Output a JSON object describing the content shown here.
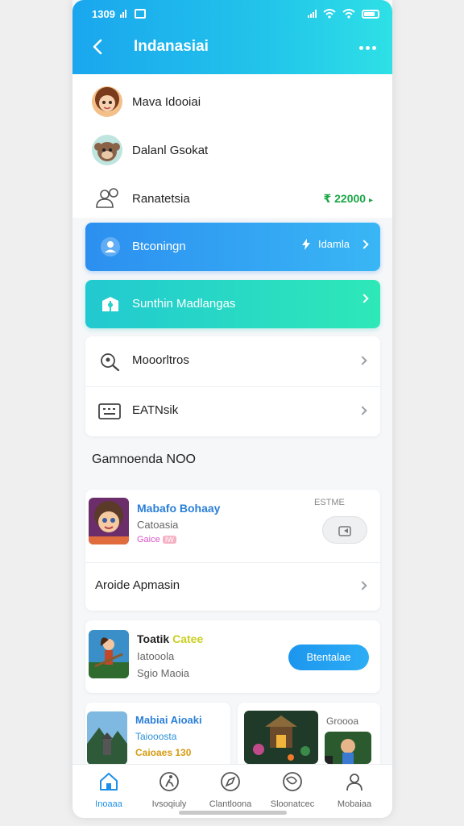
{
  "status_bar": {
    "time": "1309"
  },
  "header": {
    "title": "Indanasiai",
    "back_icon": "chevron-left-icon",
    "more_icon": "more-dots-icon"
  },
  "profile_rows": [
    {
      "label": "Mava Idooiai",
      "icon": "avatar-girl"
    },
    {
      "label": "Dalanl Gsokat",
      "icon": "avatar-monkey"
    },
    {
      "label": "Ranatetsia",
      "icon": "user-add-icon",
      "value": "₹ 22000",
      "value_color": "#1aa646"
    }
  ],
  "cta_blue": {
    "label": "Btconingn",
    "right_label": "Idamla",
    "icon": "user-icon",
    "right_icon": "bolt-icon"
  },
  "cta_teal": {
    "label": "Sunthin Madlangas",
    "icon": "gift-box-icon"
  },
  "menu_list": [
    {
      "label": "Mooorltros",
      "icon": "search-person-icon"
    },
    {
      "label": "EATNsik",
      "icon": "keyboard-icon"
    }
  ],
  "section_title": "Gamnoenda NOO",
  "game_card_1": {
    "title": "Mabafo Bohaay",
    "subtitle": "Catoasia",
    "tag": "Gaice",
    "tag_badge": "IW",
    "corner_label": "ESTME",
    "pill_icon": "share-icon",
    "footer_label": "Aroide Apmasin"
  },
  "game_card_2": {
    "title": "Toatik",
    "title_accent": "Catee",
    "line1": "Iatooola",
    "line2": "Sgio Maoia",
    "button": "Btentalae"
  },
  "game_card_3": {
    "title": "Mabiai Aioaki",
    "subtitle": "Taiooosta",
    "tag": "Caioaes 130"
  },
  "game_card_4": {
    "label": "Groooa"
  },
  "tabbar": [
    {
      "label": "Inoaaa",
      "icon": "home-icon",
      "active": true
    },
    {
      "label": "Ivsoqiuly",
      "icon": "running-icon"
    },
    {
      "label": "Clantloona",
      "icon": "compass-icon"
    },
    {
      "label": "Sloonatcec",
      "icon": "leaf-globe-icon"
    },
    {
      "label": "Mobaiaa",
      "icon": "profile-icon"
    }
  ],
  "colors": {
    "primary": "#1e8fe8",
    "teal": "#2ee0c4",
    "reward_green": "#1aa646"
  }
}
